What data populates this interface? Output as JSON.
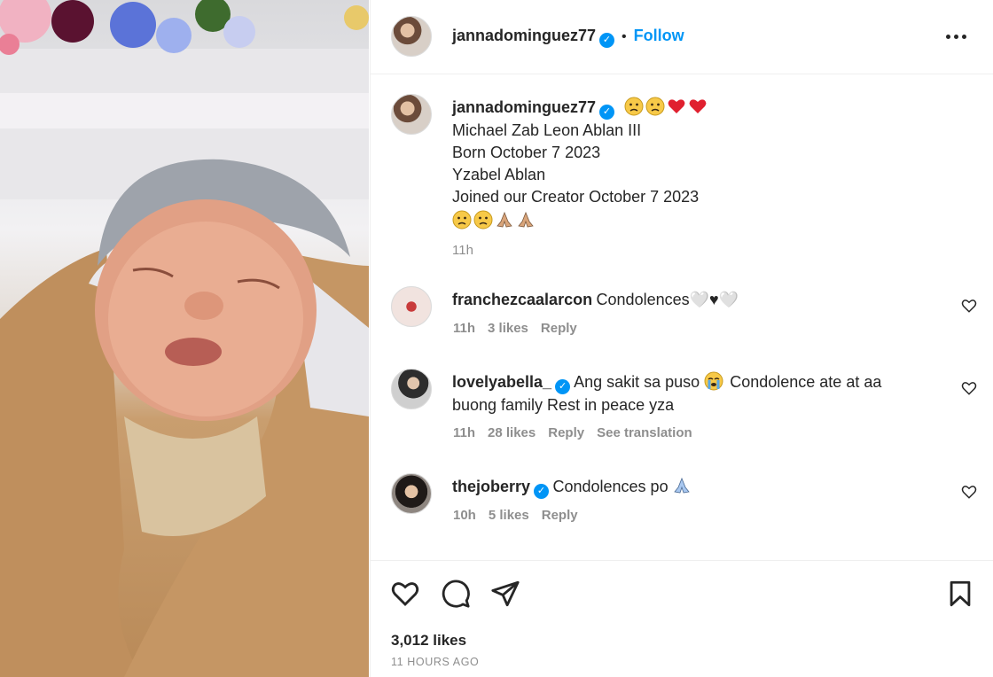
{
  "post": {
    "author": "jannadominguez77",
    "follow_label": "Follow",
    "dot": "•",
    "verified_mark": "✓",
    "caption": {
      "lines": [
        "Michael Zab Leon Ablan III",
        "Born October 7 2023",
        "Yzabel Ablan",
        "Joined our Creator October 7 2023"
      ],
      "leading_emojis": [
        "crying-face",
        "crying-face",
        "red-heart",
        "red-heart"
      ],
      "trailing_emojis": [
        "crying-face",
        "crying-face",
        "folded-hands",
        "folded-hands"
      ],
      "time": "11h"
    },
    "likes": "3,012 likes",
    "posted_ago": "11 HOURS AGO"
  },
  "comments": [
    {
      "username": "franchezcaalarcon",
      "verified": false,
      "text": "Condolences🤍♥🤍",
      "time": "11h",
      "likes": "3 likes",
      "reply": "Reply"
    },
    {
      "username": "lovelyabella_",
      "verified": true,
      "text_before_emoji": "Ang sakit sa puso",
      "text_after_emoji": "Condolence ate at aa",
      "text_line2": "buong family Rest in peace yza",
      "time": "11h",
      "likes": "28 likes",
      "reply": "Reply",
      "translation": "See translation"
    },
    {
      "username": "thejoberry",
      "verified": true,
      "text": "Condolences po",
      "time": "10h",
      "likes": "5 likes",
      "reply": "Reply"
    }
  ],
  "icons": {
    "like": "heart-icon",
    "comment": "comment-icon",
    "share": "share-icon",
    "save": "bookmark-icon",
    "more": "more-icon"
  },
  "colors": {
    "accent": "#0095f6",
    "text": "#262626",
    "muted": "#8e8e8e",
    "heart": "#e0202f"
  }
}
